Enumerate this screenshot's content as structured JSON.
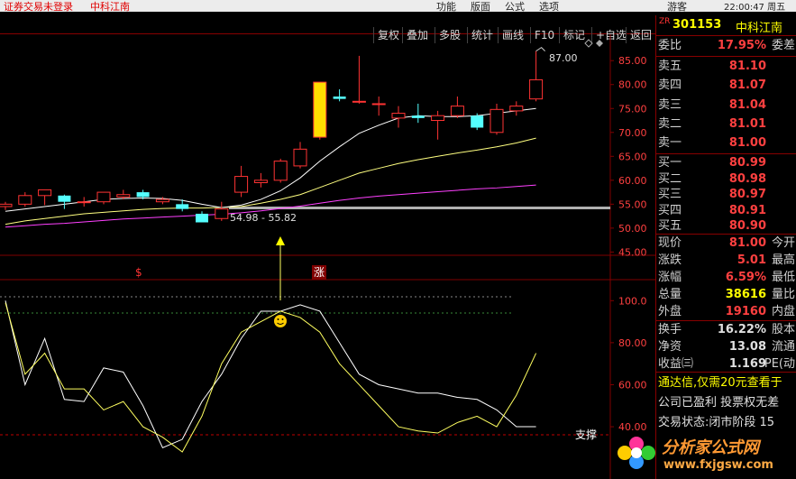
{
  "topbar": {
    "status_text": "证券交易未登录",
    "stock_name": "中科江南",
    "menus": [
      "功能",
      "版面",
      "公式",
      "选项"
    ],
    "user": "游客",
    "clock": "22:00:47 周五"
  },
  "toolbar": [
    "复权",
    "叠加",
    "多股",
    "统计",
    "画线",
    "F10",
    "标记",
    "+自选",
    "返回"
  ],
  "chart": {
    "price_label": "87.00",
    "range_label": "54.98 - 55.82",
    "marker_left": "$",
    "marker_right": "涨",
    "support_label": "支撑",
    "price_axis": [
      "85.00",
      "80.00",
      "75.00",
      "70.00",
      "65.00",
      "60.00",
      "55.00",
      "50.00",
      "45.00"
    ],
    "osc_axis": [
      "100.0",
      "80.00",
      "60.00",
      "40.00"
    ],
    "colors": {
      "up": "#ff3333",
      "down": "#54ffff",
      "ma5": "#ffffff",
      "ma10": "#ffff80",
      "ma20": "#ff40ff",
      "sep": "#800000"
    }
  },
  "chart_data": {
    "type": "candlestick",
    "ylim": [
      43,
      89
    ],
    "candles": [
      {
        "o": 54.5,
        "h": 55.5,
        "l": 53.8,
        "c": 55.0
      },
      {
        "o": 55.0,
        "h": 57.5,
        "l": 54.5,
        "c": 56.8
      },
      {
        "o": 56.8,
        "h": 58.0,
        "l": 54.8,
        "c": 58.0
      },
      {
        "o": 56.8,
        "h": 57.0,
        "l": 54.0,
        "c": 55.5
      },
      {
        "o": 55.5,
        "h": 56.5,
        "l": 54.5,
        "c": 55.5
      },
      {
        "o": 55.5,
        "h": 57.5,
        "l": 55.0,
        "c": 57.5
      },
      {
        "o": 56.5,
        "h": 58.0,
        "l": 56.0,
        "c": 57.0
      },
      {
        "o": 57.5,
        "h": 58.0,
        "l": 56.0,
        "c": 56.5
      },
      {
        "o": 55.5,
        "h": 56.5,
        "l": 55.0,
        "c": 56.0
      },
      {
        "o": 55.0,
        "h": 56.0,
        "l": 53.5,
        "c": 54.0
      },
      {
        "o": 53.0,
        "h": 53.5,
        "l": 51.2,
        "c": 51.2
      },
      {
        "o": 52.0,
        "h": 55.5,
        "l": 51.5,
        "c": 54.0
      },
      {
        "o": 57.5,
        "h": 63.0,
        "l": 56.5,
        "c": 60.8
      },
      {
        "o": 59.5,
        "h": 61.5,
        "l": 58.5,
        "c": 60.0
      },
      {
        "o": 60.0,
        "h": 64.5,
        "l": 59.5,
        "c": 64.0
      },
      {
        "o": 63.0,
        "h": 68.0,
        "l": 62.5,
        "c": 66.5
      },
      {
        "o": 69.0,
        "h": 80.5,
        "l": 68.5,
        "c": 80.5
      },
      {
        "o": 77.5,
        "h": 79.0,
        "l": 76.5,
        "c": 77.0
      },
      {
        "o": 76.5,
        "h": 86.0,
        "l": 76.0,
        "c": 76.5
      },
      {
        "o": 76.0,
        "h": 77.5,
        "l": 73.5,
        "c": 76.0
      },
      {
        "o": 73.0,
        "h": 75.5,
        "l": 71.0,
        "c": 74.0
      },
      {
        "o": 73.5,
        "h": 76.0,
        "l": 72.0,
        "c": 73.0
      },
      {
        "o": 72.5,
        "h": 74.5,
        "l": 68.5,
        "c": 73.5
      },
      {
        "o": 73.5,
        "h": 77.5,
        "l": 73.0,
        "c": 75.5
      },
      {
        "o": 73.5,
        "h": 74.0,
        "l": 70.5,
        "c": 71.0
      },
      {
        "o": 70.0,
        "h": 76.0,
        "l": 69.5,
        "c": 74.8
      },
      {
        "o": 74.5,
        "h": 76.5,
        "l": 73.5,
        "c": 75.5
      },
      {
        "o": 77.0,
        "h": 87.0,
        "l": 76.5,
        "c": 81.0
      }
    ],
    "ma5": [
      53.5,
      54.0,
      54.5,
      55.0,
      55.5,
      56.0,
      56.2,
      56.3,
      56.2,
      55.8,
      55.0,
      54.3,
      54.8,
      56.0,
      57.8,
      60.5,
      64.0,
      67.0,
      69.8,
      71.5,
      73.0,
      73.5,
      73.3,
      73.3,
      73.5,
      74.0,
      74.5,
      75.0
    ],
    "ma10": [
      50.8,
      51.5,
      52.0,
      52.5,
      53.0,
      53.3,
      53.6,
      53.9,
      54.1,
      54.2,
      54.2,
      54.3,
      54.5,
      55.2,
      56.0,
      57.0,
      58.5,
      60.0,
      61.5,
      62.5,
      63.5,
      64.3,
      65.0,
      65.7,
      66.3,
      67.0,
      67.8,
      68.8
    ],
    "ma20": [
      50.2,
      50.5,
      50.8,
      51.0,
      51.3,
      51.6,
      51.9,
      52.1,
      52.3,
      52.5,
      52.7,
      52.9,
      53.2,
      53.6,
      54.1,
      54.6,
      55.2,
      55.8,
      56.3,
      56.7,
      57.0,
      57.3,
      57.6,
      57.9,
      58.2,
      58.4,
      58.7,
      59.0
    ],
    "osc_ylim": [
      25,
      110
    ],
    "osc_white": [
      100,
      60,
      82,
      53,
      52,
      68,
      66,
      50,
      30,
      34,
      52,
      65,
      82,
      95,
      95,
      98,
      95,
      80,
      65,
      60,
      58,
      56,
      56,
      54,
      53,
      48,
      40,
      40
    ],
    "osc_yellow": [
      99,
      65,
      75,
      58,
      58,
      48,
      52,
      40,
      35,
      28,
      45,
      70,
      85,
      90,
      95,
      92,
      85,
      70,
      60,
      50,
      40,
      38,
      37,
      42,
      45,
      40,
      55,
      75
    ]
  },
  "quote": {
    "code_tag": "ZR",
    "code": "301153",
    "name": "中科江南",
    "weibi_label": "委比",
    "weibi": "17.95%",
    "weicha_label": "委差",
    "asks": [
      {
        "label": "卖五",
        "price": "81.10"
      },
      {
        "label": "卖四",
        "price": "81.07"
      },
      {
        "label": "卖三",
        "price": "81.04"
      },
      {
        "label": "卖二",
        "price": "81.01"
      },
      {
        "label": "卖一",
        "price": "81.00"
      }
    ],
    "bids": [
      {
        "label": "买一",
        "price": "80.99"
      },
      {
        "label": "买二",
        "price": "80.98"
      },
      {
        "label": "买三",
        "price": "80.97"
      },
      {
        "label": "买四",
        "price": "80.91"
      },
      {
        "label": "买五",
        "price": "80.90"
      }
    ],
    "stats": [
      {
        "label": "现价",
        "value": "81.00",
        "label2": "今开"
      },
      {
        "label": "涨跌",
        "value": "5.01",
        "label2": "最高"
      },
      {
        "label": "涨幅",
        "value": "6.59%",
        "label2": "最低"
      },
      {
        "label": "总量",
        "value": "38616",
        "label2": "量比"
      },
      {
        "label": "外盘",
        "value": "19160",
        "label2": "内盘"
      }
    ],
    "stats2": [
      {
        "label": "换手",
        "value": "16.22%",
        "label2": "股本"
      },
      {
        "label": "净资",
        "value": "13.08",
        "label2": "流通"
      },
      {
        "label": "收益㈢",
        "value": "1.169",
        "label2": "PE(动"
      }
    ],
    "notice1": "通达信,仅需20元查看于",
    "notice2": "公司已盈利 投票权无差",
    "notice3": "交易状态:闭市阶段 15"
  },
  "logo": {
    "title": "分析家公式网",
    "url": "www.fxjgsw.com"
  }
}
